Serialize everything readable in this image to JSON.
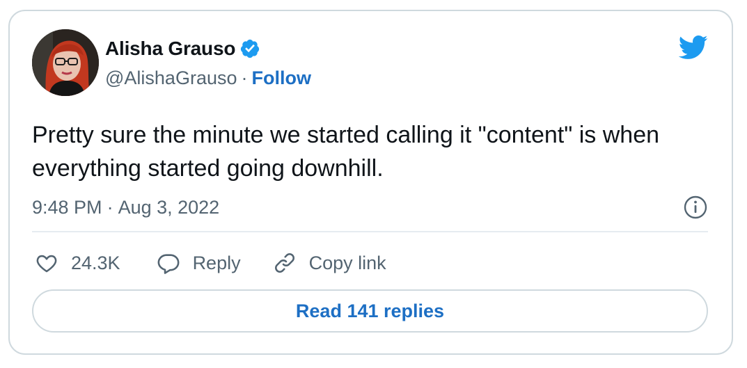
{
  "author": {
    "name": "Alisha Grauso",
    "handle": "@AlishaGrauso",
    "separator": "·",
    "follow_label": "Follow"
  },
  "tweet": {
    "text": "Pretty sure the minute we started calling it \"content\" is when everything started going downhill.",
    "time": "9:48 PM",
    "separator": "·",
    "date": "Aug 3, 2022"
  },
  "actions": {
    "like_count": "24.3K",
    "reply_label": "Reply",
    "copy_link_label": "Copy link"
  },
  "read_replies_label": "Read 141 replies",
  "icons": {
    "brand": "twitter-bird-icon",
    "verified": "verified-badge-icon",
    "info": "info-icon",
    "like": "heart-icon",
    "reply": "reply-bubble-icon",
    "copy_link": "link-icon"
  },
  "colors": {
    "twitter_blue": "#1d9bf0",
    "link_blue": "#1d6fc4",
    "text_primary": "#0f1419",
    "text_secondary": "#536471",
    "border": "#cfd9de"
  }
}
